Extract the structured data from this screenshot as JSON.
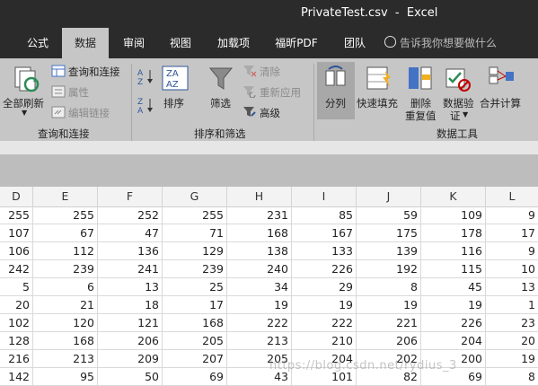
{
  "window": {
    "title": "PrivateTest.csv  -  Excel"
  },
  "ribbon_tabs": [
    {
      "label": "公式"
    },
    {
      "label": "数据"
    },
    {
      "label": "审阅"
    },
    {
      "label": "视图"
    },
    {
      "label": "加载项"
    },
    {
      "label": "福昕PDF"
    },
    {
      "label": "团队"
    }
  ],
  "tell_me": {
    "placeholder": "告诉我你想要做什么"
  },
  "groups": {
    "query": {
      "label": "查询和连接",
      "refresh_all": "全部刷新",
      "queries_connections": "查询和连接",
      "properties": "属性",
      "edit_links": "编辑链接"
    },
    "sort_filter": {
      "label": "排序和筛选",
      "sort": "排序",
      "filter": "筛选",
      "clear": "清除",
      "reapply": "重新应用",
      "advanced": "高级"
    },
    "data_tools": {
      "label": "数据工具",
      "text_to_columns": "分列",
      "flash_fill": "快速填充",
      "remove_duplicates_1": "删除",
      "remove_duplicates_2": "重复值",
      "data_validation_1": "数据验",
      "data_validation_2": "证",
      "consolidate": "合并计算"
    }
  },
  "sheet": {
    "columns": [
      "D",
      "E",
      "F",
      "G",
      "H",
      "I",
      "J",
      "K",
      "L"
    ],
    "rows": [
      [
        "255",
        "255",
        "252",
        "255",
        "231",
        "85",
        "59",
        "109",
        "9"
      ],
      [
        "107",
        "67",
        "47",
        "71",
        "168",
        "167",
        "175",
        "178",
        "17"
      ],
      [
        "106",
        "112",
        "136",
        "129",
        "138",
        "133",
        "139",
        "116",
        "9"
      ],
      [
        "242",
        "239",
        "241",
        "239",
        "240",
        "226",
        "192",
        "115",
        "10"
      ],
      [
        "5",
        "6",
        "13",
        "25",
        "34",
        "29",
        "8",
        "45",
        "13"
      ],
      [
        "20",
        "21",
        "18",
        "17",
        "19",
        "19",
        "19",
        "19",
        "1"
      ],
      [
        "102",
        "120",
        "121",
        "168",
        "222",
        "222",
        "221",
        "226",
        "23"
      ],
      [
        "128",
        "168",
        "206",
        "205",
        "213",
        "210",
        "206",
        "204",
        "20"
      ],
      [
        "216",
        "213",
        "209",
        "207",
        "205",
        "204",
        "202",
        "200",
        "19"
      ],
      [
        "142",
        "95",
        "50",
        "69",
        "43",
        "101",
        "82",
        "69",
        "8"
      ],
      [
        "31",
        "56",
        "59",
        "66",
        "85",
        "59",
        "50",
        "66",
        "6"
      ]
    ]
  },
  "watermark": "https://blog.csdn.net/rydius_3"
}
